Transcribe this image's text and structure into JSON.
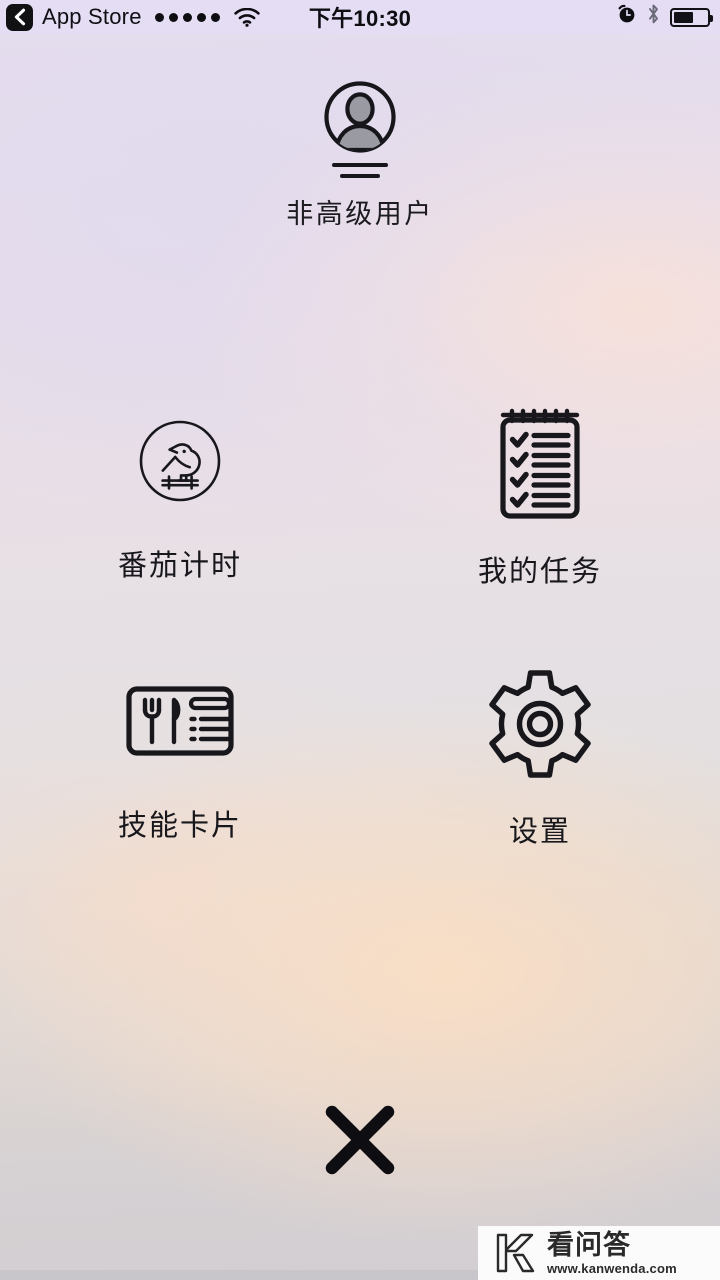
{
  "status_bar": {
    "back_label": "App Store",
    "back_icon": "chevron-left-icon",
    "signal_icon": "signal-dots-icon",
    "signal_dots": 5,
    "wifi_icon": "wifi-icon",
    "time": "下午10:30",
    "alarm_icon": "alarm-clock-icon",
    "bluetooth_icon": "bluetooth-icon",
    "battery_icon": "battery-icon",
    "battery_level_percent": 60,
    "background_color": "#e4ddf4",
    "foreground_color": "#0d0d12"
  },
  "profile": {
    "avatar_icon": "user-avatar-icon",
    "name": "非高级用户"
  },
  "menu": {
    "items": [
      {
        "id": "pomodoro",
        "label": "番茄计时",
        "icon": "bird-in-circle-icon"
      },
      {
        "id": "tasks",
        "label": "我的任务",
        "icon": "notepad-checklist-icon"
      },
      {
        "id": "skills",
        "label": "技能卡片",
        "icon": "menu-card-icon"
      },
      {
        "id": "settings",
        "label": "设置",
        "icon": "gear-icon"
      }
    ]
  },
  "close": {
    "icon": "close-x-icon",
    "label": "关闭"
  },
  "watermark": {
    "logo_icon": "kanwenda-k-logo-icon",
    "brand": "看问答",
    "url": "www.kanwenda.com"
  },
  "theme": {
    "ink": "#17171c",
    "background_top": "#e6dff0",
    "background_bottom": "#d2ced2",
    "glow_warm": "#fadec4"
  }
}
